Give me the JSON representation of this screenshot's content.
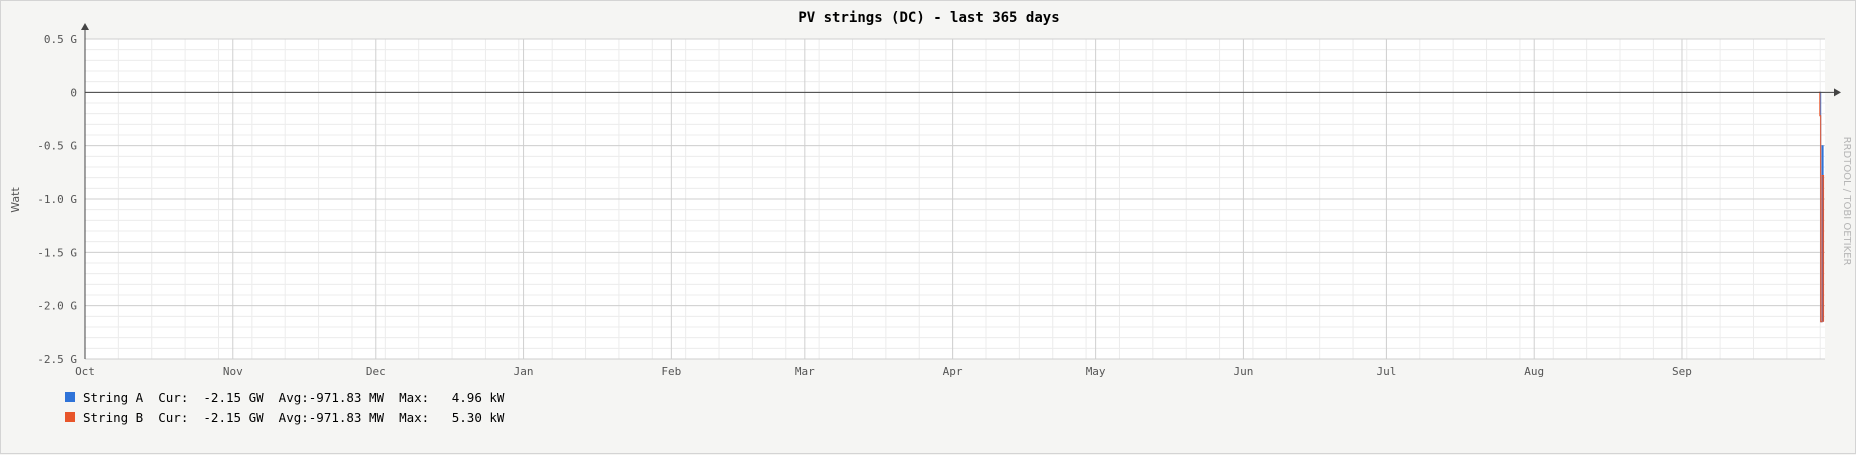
{
  "chart_data": {
    "type": "line",
    "title": "PV strings (DC) - last 365 days",
    "ylabel": "Watt",
    "xlabel": "",
    "watermark": "RRDTOOL / TOBI OETIKER",
    "ylim": [
      -2.5,
      0.5
    ],
    "y_unit": "G",
    "y_ticks": [
      {
        "value": 0.5,
        "label": "0.5 G"
      },
      {
        "value": 0,
        "label": "0"
      },
      {
        "value": -0.5,
        "label": "-0.5 G"
      },
      {
        "value": -1.0,
        "label": "-1.0 G"
      },
      {
        "value": -1.5,
        "label": "-1.5 G"
      },
      {
        "value": -2.0,
        "label": "-2.0 G"
      },
      {
        "value": -2.5,
        "label": "-2.5 G"
      }
    ],
    "x_domain": [
      0,
      365
    ],
    "x_ticks": [
      {
        "day": 0,
        "label": "Oct"
      },
      {
        "day": 31,
        "label": "Nov"
      },
      {
        "day": 61,
        "label": "Dec"
      },
      {
        "day": 92,
        "label": "Jan"
      },
      {
        "day": 123,
        "label": "Feb"
      },
      {
        "day": 151,
        "label": "Mar"
      },
      {
        "day": 182,
        "label": "Apr"
      },
      {
        "day": 212,
        "label": "May"
      },
      {
        "day": 243,
        "label": "Jun"
      },
      {
        "day": 273,
        "label": "Jul"
      },
      {
        "day": 304,
        "label": "Aug"
      },
      {
        "day": 335,
        "label": "Sep"
      }
    ],
    "grid": true,
    "legend_position": "bottom-left",
    "series": [
      {
        "name": "String A",
        "color": "#2f73d8",
        "cur": "-2.15 GW",
        "avg": "-971.83 MW",
        "max": "4.96 kW",
        "points": [
          [
            363.9,
            0
          ],
          [
            364.1,
            -2.15
          ],
          [
            364.4,
            -0.5
          ],
          [
            364.6,
            -2.15
          ]
        ]
      },
      {
        "name": "String B",
        "color": "#e8552a",
        "cur": "-2.15 GW",
        "avg": "-971.83 MW",
        "max": "5.30 kW",
        "points": [
          [
            363.7,
            0
          ],
          [
            363.9,
            -0.22
          ],
          [
            364.1,
            -2.15
          ],
          [
            364.4,
            -0.78
          ],
          [
            364.7,
            -2.15
          ]
        ]
      }
    ]
  }
}
